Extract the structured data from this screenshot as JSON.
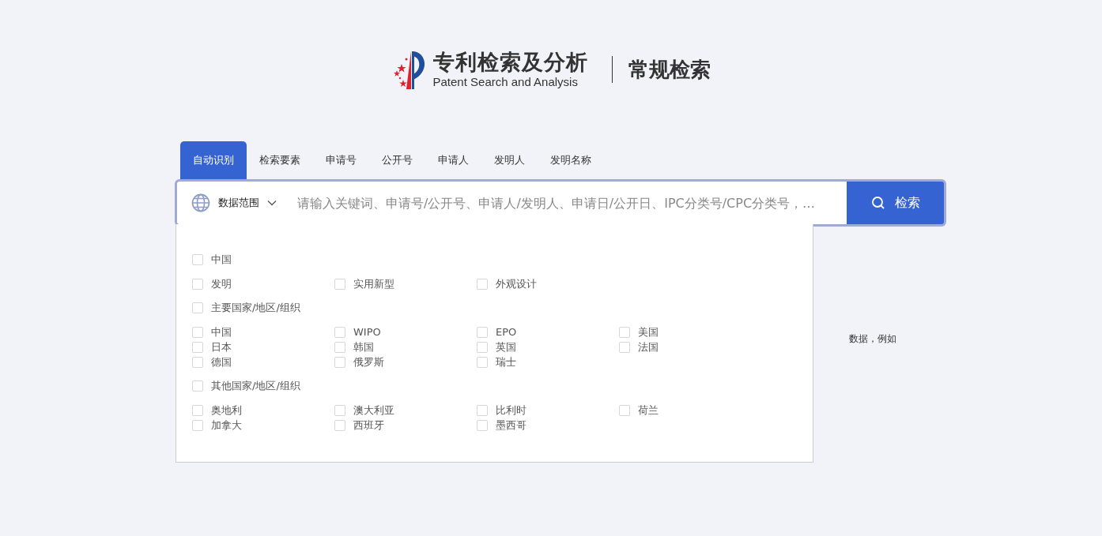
{
  "header": {
    "logo_title": "专利检索及分析",
    "logo_subtitle": "Patent Search and Analysis",
    "page_title": "常规检索"
  },
  "tabs": [
    {
      "label": "自动识别",
      "selected": true
    },
    {
      "label": "检索要素",
      "selected": false
    },
    {
      "label": "申请号",
      "selected": false
    },
    {
      "label": "公开号",
      "selected": false
    },
    {
      "label": "申请人",
      "selected": false
    },
    {
      "label": "发明人",
      "selected": false
    },
    {
      "label": "发明名称",
      "selected": false
    }
  ],
  "search": {
    "scope_label": "数据范围",
    "placeholder": "请输入关键词、申请号/公开号、申请人/发明人、申请日/公开日、IPC分类号/CPC分类号，…",
    "button": "检索"
  },
  "scope_groups": [
    {
      "label": "中国",
      "checked": false,
      "items": [
        {
          "label": "发明",
          "checked": false
        },
        {
          "label": "实用新型",
          "checked": false
        },
        {
          "label": "外观设计",
          "checked": false
        }
      ]
    },
    {
      "label": "主要国家/地区/组织",
      "checked": false,
      "items": [
        {
          "label": "中国",
          "checked": false
        },
        {
          "label": "WIPO",
          "checked": false
        },
        {
          "label": "EPO",
          "checked": false
        },
        {
          "label": "美国",
          "checked": false
        },
        {
          "label": "日本",
          "checked": false
        },
        {
          "label": "韩国",
          "checked": false
        },
        {
          "label": "英国",
          "checked": false
        },
        {
          "label": "法国",
          "checked": false
        },
        {
          "label": "德国",
          "checked": false
        },
        {
          "label": "俄罗斯",
          "checked": false
        },
        {
          "label": "瑞士",
          "checked": false
        }
      ]
    },
    {
      "label": "其他国家/地区/组织",
      "checked": false,
      "items": [
        {
          "label": "奥地利",
          "checked": false
        },
        {
          "label": "澳大利亚",
          "checked": false
        },
        {
          "label": "比利时",
          "checked": false
        },
        {
          "label": "荷兰",
          "checked": false
        },
        {
          "label": "加拿大",
          "checked": false
        },
        {
          "label": "西班牙",
          "checked": false
        },
        {
          "label": "墨西哥",
          "checked": false
        }
      ]
    }
  ],
  "background_hint": "数据，例如"
}
